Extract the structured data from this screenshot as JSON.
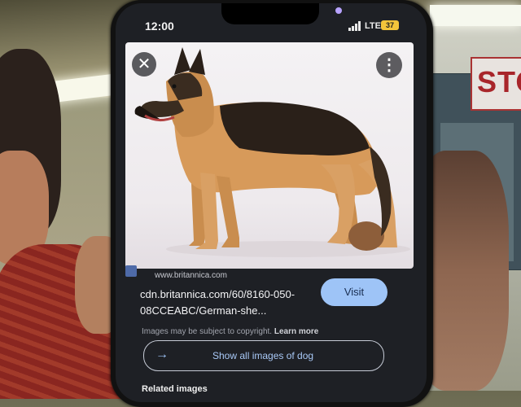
{
  "status_bar": {
    "time": "12:00",
    "network": "LTE",
    "battery": "37"
  },
  "image_viewer": {
    "close_icon": "close-icon",
    "more_icon": "more-vertical-icon",
    "image_subject": "German shepherd dog"
  },
  "result": {
    "source_domain": "www.britannica.com",
    "url_line1": "cdn.britannica.com/60/8160-050-",
    "url_line2": "08CCEABC/German-she...",
    "visit_label": "Visit",
    "copyright_text": "Images may be subject to copyright.",
    "learn_more": "Learn more",
    "show_all_label": "Show all images of dog",
    "related_heading": "Related images"
  },
  "background": {
    "sign_text": "STO"
  },
  "colors": {
    "accent": "#9ec4f7",
    "screen_bg": "#1e2025",
    "battery": "#f3c43b"
  }
}
